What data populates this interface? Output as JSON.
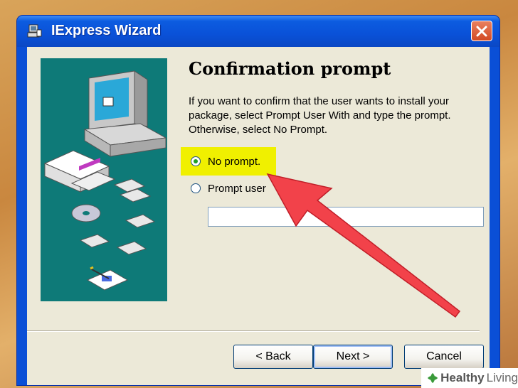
{
  "window": {
    "title": "IExpress Wizard",
    "close_icon": "close-icon"
  },
  "page": {
    "heading": "Confirmation prompt",
    "description": "If you want to confirm that the user wants to install your package, select Prompt User With and type the prompt. Otherwise, select No Prompt."
  },
  "options": [
    {
      "label": "No prompt.",
      "selected": true
    },
    {
      "label": "Prompt user",
      "selected": false
    }
  ],
  "prompt_input": {
    "value": ""
  },
  "buttons": {
    "back": "< Back",
    "next": "Next >",
    "cancel": "Cancel"
  },
  "watermark": {
    "brand_bold": "Healthy",
    "brand_light": "Living"
  },
  "colors": {
    "titlebar": "#0a51d8",
    "highlight": "#f0f000",
    "arrow": "#f2424a",
    "art_background": "#0e7a78"
  }
}
